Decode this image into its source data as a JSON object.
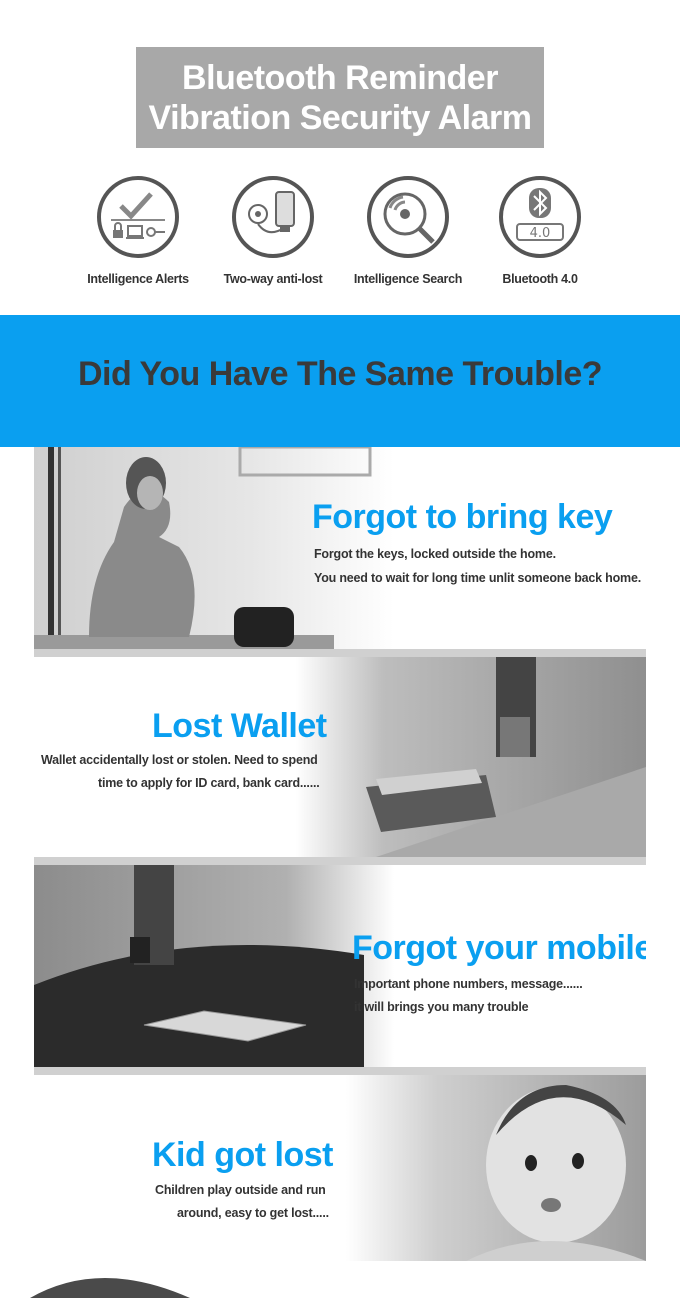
{
  "header": {
    "title_line1": "Bluetooth Reminder",
    "title_line2": "Vibration Security Alarm"
  },
  "features": [
    {
      "label": "Intelligence Alerts",
      "icon": "check-alerts-icon"
    },
    {
      "label": "Two-way anti-lost",
      "icon": "phone-tag-icon"
    },
    {
      "label": "Intelligence Search",
      "icon": "search-signal-icon"
    },
    {
      "label": "Bluetooth 4.0",
      "icon": "bluetooth-icon"
    }
  ],
  "bluetooth_version": "4.0",
  "banner": {
    "heading": "Did You Have The Same Trouble?"
  },
  "stories": [
    {
      "title": "Forgot to bring key",
      "line1": "Forgot the keys, locked outside the home.",
      "line2": "You need to wait for long time unlit someone back home."
    },
    {
      "title": "Lost Wallet",
      "line1": "Wallet accidentally lost or stolen. Need to spend",
      "line2": "time to apply for ID card, bank card......"
    },
    {
      "title": "Forgot your mobile",
      "line1": "Important phone numbers, message......",
      "line2": "it will brings you many trouble"
    },
    {
      "title": "Kid got lost",
      "line1": "Children play outside and run",
      "line2": "around, easy to get lost....."
    }
  ],
  "colors": {
    "accent": "#0a9ff0",
    "title_box": "#a8a8a8",
    "heading_text": "#3a3a3a"
  }
}
